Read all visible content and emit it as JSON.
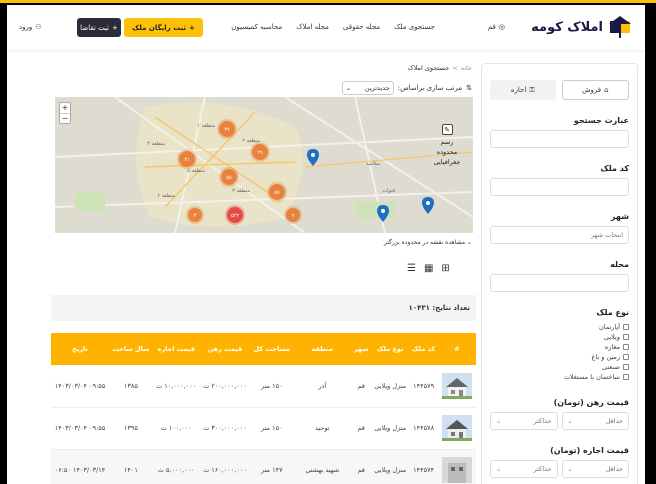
{
  "header": {
    "logo_text": "املاک کومه",
    "city": "قم",
    "nav": [
      "جستجوی ملک",
      "مجله حقوقی",
      "مجله املاک",
      "محاسبه کمیسیون"
    ],
    "free_listing": "ثبت رایگان ملک",
    "request": "ثبت تقاضا",
    "login": "ورود"
  },
  "sidebar": {
    "sale": "فروش",
    "rent": "اجاره",
    "search_label": "عبارت جستجو",
    "code_label": "کد ملک",
    "city_label": "شهر",
    "city_value": "انتخاب شهر",
    "area_label": "محله",
    "type_label": "نوع ملک",
    "types": [
      "آپارتمان",
      "ویلایی",
      "مغازه",
      "زمین و باغ",
      "صنعتی",
      "ساختمان با مستغلات"
    ],
    "deposit_label": "قیمت رهن (تومان)",
    "rent_label": "قیمت اجاره (تومان)",
    "min": "حداقل",
    "max": "حداکثر"
  },
  "main": {
    "breadcrumb_home": "خانه",
    "breadcrumb_sep": ">",
    "breadcrumb_current": "جستجوی املاک",
    "sort_label": "مرتب سازی براساس:",
    "sort_value": "جدیدترین",
    "draw_line1": "رسم",
    "draw_line2": "محدوده",
    "draw_line3": "جغرافیایی",
    "bigger_area": "مشاهده نقشه در محدوده بزرگتر",
    "results": "تعداد نتایج: ۱۰۴۳۱",
    "zoom_in": "+",
    "zoom_out": "−"
  },
  "map": {
    "clusters": [
      "۳۷",
      "۲۹",
      "۳۱",
      "۵۸",
      "۵۷",
      "۳",
      "۵۲۲",
      "۷"
    ],
    "labels": [
      "منطقه ۴",
      "منطقه ۵",
      "منطقه ۶",
      "منطقه ۳",
      "منطقه ۲",
      "منطقه ۱",
      "قنوات",
      "سلامیه"
    ]
  },
  "table": {
    "headers": [
      "#",
      "کد ملک",
      "نوع ملک",
      "شهر",
      "منطقه",
      "مساحت کل",
      "قیمت رهن",
      "قیمت اجاره",
      "سال ساخت",
      "تاریخ"
    ],
    "rows": [
      [
        "",
        "۱۴۴۵۷۹",
        "منزل ویلایی",
        "قم",
        "آذر",
        "۱۵۰ متر",
        "۲۰۰,۰۰۰,۰۰۰ ت",
        "۱۰,۰۰۰,۰۰۰ ت",
        "۱۳۸۵",
        "۰۹:۵۵ ۱۴۰۳/۰۳/۰۴"
      ],
      [
        "",
        "۱۴۴۵۷۸",
        "منزل ویلایی",
        "قم",
        "توحید",
        "۱۵۰ متر",
        "۳۰۰,۰۰۰,۰۰۰ ت",
        "۱۰۰,۰۰۰ ت",
        "۱۳۹۵",
        "۰۹:۵۵ ۱۴۰۳/۰۳/۰۴"
      ],
      [
        "",
        "۱۴۴۵۷۴",
        "منزل ویلایی",
        "قم",
        "شهید بهشتی",
        "۱۴۷ متر",
        "۱۶۰,۰۰۰,۰۰۰ ت",
        "۵,۰۰۰,۰۰۰ ت",
        "۱۴۰۱",
        "۱۴۰۳/۰۳/۱۴ ۰۶:۵۰"
      ]
    ]
  },
  "colors": {
    "accent": "#ffb300",
    "dark": "#2b2b3a",
    "cluster": "#e8772e",
    "pin": "#1e6fc4"
  }
}
